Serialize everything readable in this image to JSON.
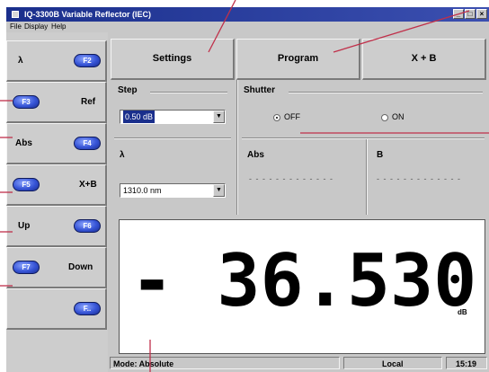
{
  "window": {
    "title": "IQ-3300B Variable Reflector (IEC)"
  },
  "menu": [
    "File",
    "Display",
    "Help"
  ],
  "fkeys": [
    {
      "key": "F2",
      "label": "λ"
    },
    {
      "key": "F3",
      "label": "Ref"
    },
    {
      "key": "F4",
      "label": "Abs"
    },
    {
      "key": "F5",
      "label": "X+B"
    },
    {
      "key": "F6",
      "label": "Up"
    },
    {
      "key": "F7",
      "label": "Down"
    },
    {
      "key": "F..",
      "label": ""
    }
  ],
  "top_buttons": [
    "Settings",
    "Program",
    "X + B"
  ],
  "step": {
    "title": "Step",
    "value": "0.50 dB"
  },
  "lambda": {
    "title": "λ",
    "value": "1310.0 nm"
  },
  "shutter": {
    "title": "Shutter",
    "off_label": "OFF",
    "on_label": "ON",
    "selected": "OFF"
  },
  "abs": {
    "title": "Abs",
    "value": "- - - - - - - - - - - - -"
  },
  "b": {
    "title": "B",
    "value": "- - - - - - - - - - - - -"
  },
  "reading": {
    "value": "- 36.530",
    "unit": "dB"
  },
  "status": {
    "mode": "Mode: Absolute",
    "control": "Local",
    "time": "15:19"
  },
  "colors": {
    "titlebar": "#1a2f8c",
    "key_pill": "#3654d6",
    "callout_line": "#c0304a"
  }
}
